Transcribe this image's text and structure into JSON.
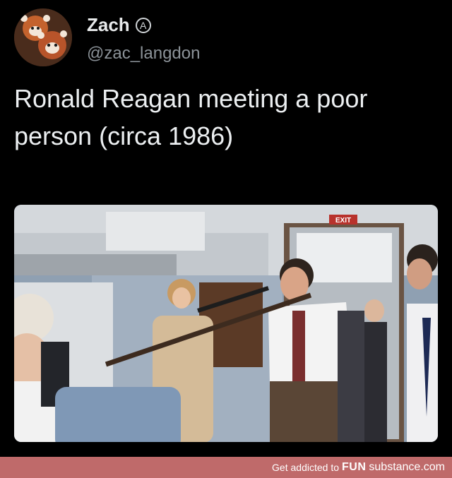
{
  "tweet": {
    "author_name": "Zach",
    "badge_glyph": "A",
    "handle": "@zac_langdon",
    "text": "Ronald Reagan meeting a poor person (circa 1986)",
    "avatar_icon": "red-panda-avatar",
    "photo_sign": "EXIT"
  },
  "footer": {
    "tagline": "Get addicted to",
    "brand_bold": "FUN",
    "brand_regular": "substance.com"
  }
}
